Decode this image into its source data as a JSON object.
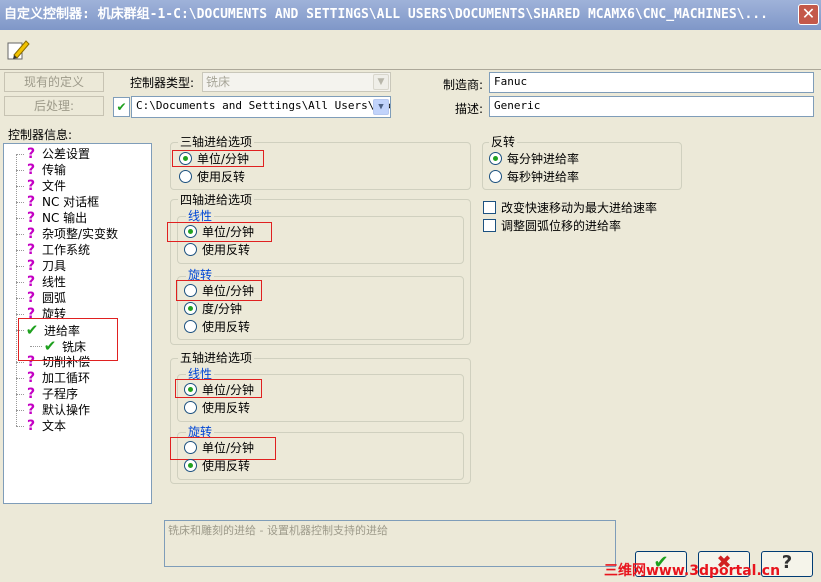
{
  "window": {
    "title": "自定义控制器: 机床群组-1-C:\\DOCUMENTS AND SETTINGS\\ALL USERS\\DOCUMENTS\\SHARED MCAMX6\\CNC_MACHINES\\...",
    "close_icon": "close-icon"
  },
  "toolbar": {
    "edit_icon": "pencil-edit-icon"
  },
  "buttons": {
    "existing_definition": "现有的定义",
    "post_process": "后处理:"
  },
  "controller_type": {
    "label": "控制器类型:",
    "value": "铣床"
  },
  "post_path": {
    "value": "C:\\Documents and Settings\\All Users\\Docu"
  },
  "manufacturer": {
    "label": "制造商:",
    "value": "Fanuc"
  },
  "description": {
    "label": "描述:",
    "value": "Generic"
  },
  "controller_info": {
    "label": "控制器信息:",
    "items": [
      {
        "label": "公差设置",
        "icon": "question-icon"
      },
      {
        "label": "传输",
        "icon": "question-icon"
      },
      {
        "label": "文件",
        "icon": "question-icon"
      },
      {
        "label": "NC 对话框",
        "icon": "question-icon"
      },
      {
        "label": "NC 输出",
        "icon": "question-icon"
      },
      {
        "label": "杂项整/实变数",
        "icon": "question-icon"
      },
      {
        "label": "工作系统",
        "icon": "question-icon"
      },
      {
        "label": "刀具",
        "icon": "question-icon"
      },
      {
        "label": "线性",
        "icon": "question-icon"
      },
      {
        "label": "圆弧",
        "icon": "question-icon"
      },
      {
        "label": "旋转",
        "icon": "question-icon"
      },
      {
        "label": "进给率",
        "icon": "check-icon"
      },
      {
        "label": "铣床",
        "icon": "check-icon"
      },
      {
        "label": "切削补偿",
        "icon": "question-icon"
      },
      {
        "label": "加工循环",
        "icon": "question-icon"
      },
      {
        "label": "子程序",
        "icon": "question-icon"
      },
      {
        "label": "默认操作",
        "icon": "question-icon"
      },
      {
        "label": "文本",
        "icon": "question-icon"
      }
    ]
  },
  "three_axis": {
    "title": "三轴进给选项",
    "opt1": "单位/分钟",
    "opt2": "使用反转"
  },
  "four_axis": {
    "title": "四轴进给选项",
    "linear_title": "线性",
    "linear_opt1": "单位/分钟",
    "linear_opt2": "使用反转",
    "rotary_title": "旋转",
    "rotary_opt1": "单位/分钟",
    "rotary_opt2": "度/分钟",
    "rotary_opt3": "使用反转"
  },
  "five_axis": {
    "title": "五轴进给选项",
    "linear_title": "线性",
    "linear_opt1": "单位/分钟",
    "linear_opt2": "使用反转",
    "rotary_title": "旋转",
    "rotary_opt1": "单位/分钟",
    "rotary_opt2": "使用反转"
  },
  "reverse": {
    "title": "反转",
    "opt1": "每分钟进给率",
    "opt2": "每秒钟进给率"
  },
  "checks": {
    "rapid": "改变快速移动为最大进给速率",
    "arc": "调整圆弧位移的进给率"
  },
  "status_description": "铣床和雕刻的进给 - 设置机器控制支持的进给",
  "dialog_buttons": {
    "ok_icon": "check-icon",
    "cancel_icon": "cancel-x-icon",
    "help_label": "?"
  },
  "watermark": "三维网www.3dportal.cn",
  "colors": {
    "title_bar": "#8ea3d2",
    "dialog_bg": "#ece9d8",
    "highlight_red": "#e02020",
    "radio_dot": "#21a121"
  }
}
